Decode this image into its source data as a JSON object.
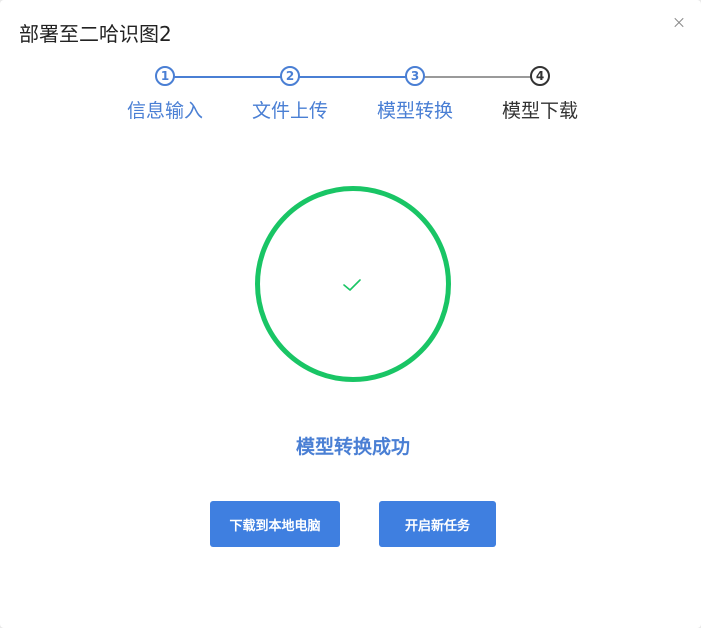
{
  "dialog": {
    "title": "部署至二哈识图2"
  },
  "steps": [
    {
      "number": "1",
      "label": "信息输入",
      "status": "done"
    },
    {
      "number": "2",
      "label": "文件上传",
      "status": "done"
    },
    {
      "number": "3",
      "label": "模型转换",
      "status": "done"
    },
    {
      "number": "4",
      "label": "模型下载",
      "status": "current"
    }
  ],
  "result": {
    "message": "模型转换成功",
    "icon": "check-icon",
    "ring_color": "#19c565"
  },
  "actions": {
    "download_label": "下载到本地电脑",
    "new_task_label": "开启新任务"
  },
  "colors": {
    "accent": "#4a7fd4",
    "button": "#3f7fe0",
    "success": "#19c565"
  }
}
